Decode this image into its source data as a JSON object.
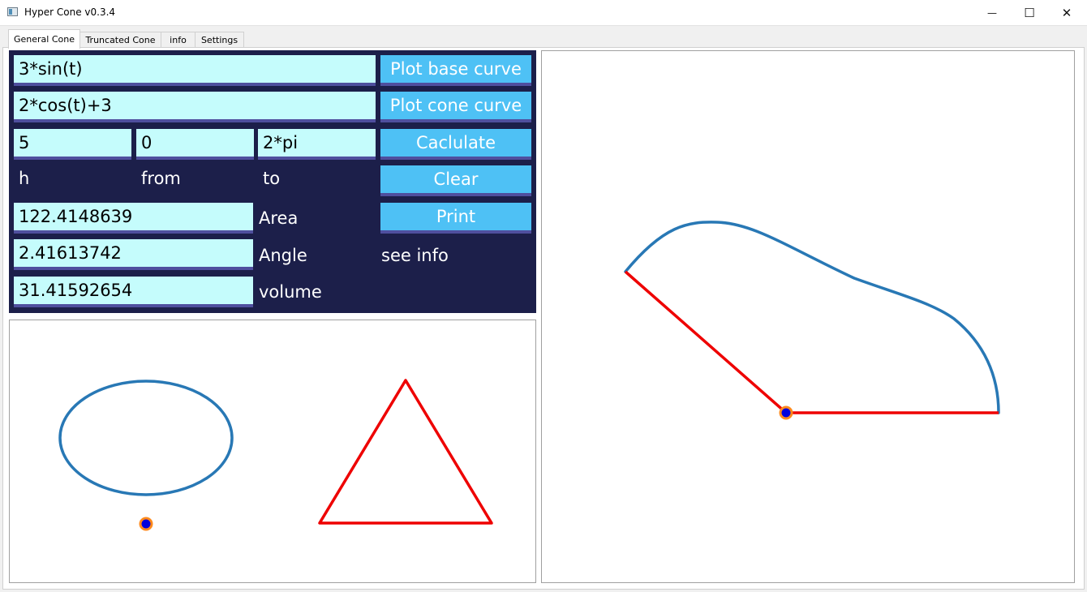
{
  "window": {
    "title": "Hyper Cone v0.3.4",
    "minimize_glyph": "—",
    "maximize_glyph": "☐",
    "close_glyph": "✕"
  },
  "tabs": [
    {
      "label": "General Cone",
      "active": true
    },
    {
      "label": "Truncated Cone",
      "active": false
    },
    {
      "label": "info",
      "active": false
    },
    {
      "label": "Settings",
      "active": false
    }
  ],
  "inputs": {
    "x_expr": "3*sin(t)",
    "y_expr": "2*cos(t)+3",
    "h": "5",
    "from": "0",
    "to": "2*pi",
    "area": "122.4148639",
    "angle": "2.41613742",
    "volume": "31.41592654"
  },
  "labels": {
    "h": "h",
    "from": "from",
    "to": "to",
    "area": "Area",
    "angle": "Angle",
    "volume": "volume",
    "see_info": "see info"
  },
  "buttons": {
    "plot_base": "Plot base curve",
    "plot_cone": "Plot cone curve",
    "calculate": "Caclulate",
    "clear": "Clear",
    "print": "Print"
  },
  "colors": {
    "panel_bg": "#1c1f4a",
    "field_bg": "#c5fcfc",
    "button_bg": "#4ec1f5",
    "curve": "#2878b5",
    "line": "#ee0000",
    "point_fill": "#0000dd",
    "point_stroke": "#ff8a1c"
  }
}
